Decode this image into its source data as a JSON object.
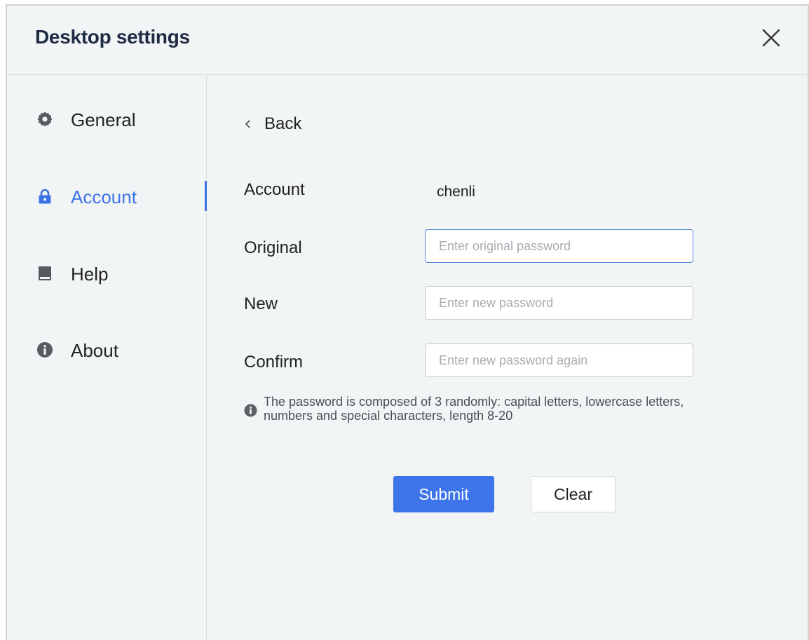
{
  "window": {
    "title": "Desktop settings"
  },
  "sidebar": {
    "items": [
      {
        "label": "General",
        "icon": "gear-icon",
        "active": false
      },
      {
        "label": "Account",
        "icon": "lock-icon",
        "active": true
      },
      {
        "label": "Help",
        "icon": "book-icon",
        "active": false
      },
      {
        "label": "About",
        "icon": "info-icon",
        "active": false
      }
    ]
  },
  "content": {
    "back_label": "Back",
    "account_label": "Account",
    "account_value": "chenli",
    "original_label": "Original",
    "original_placeholder": "Enter original password",
    "new_label": "New",
    "new_placeholder": "Enter new password",
    "confirm_label": "Confirm",
    "confirm_placeholder": "Enter new password again",
    "hint": "The password is composed  of 3 randomly: capital letters, lowercase letters, numbers and special characters, length 8-20",
    "submit_label": "Submit",
    "clear_label": "Clear"
  },
  "colors": {
    "accent": "#3b73e6",
    "background": "#f2f5f5",
    "icon_gray": "#555b61"
  }
}
